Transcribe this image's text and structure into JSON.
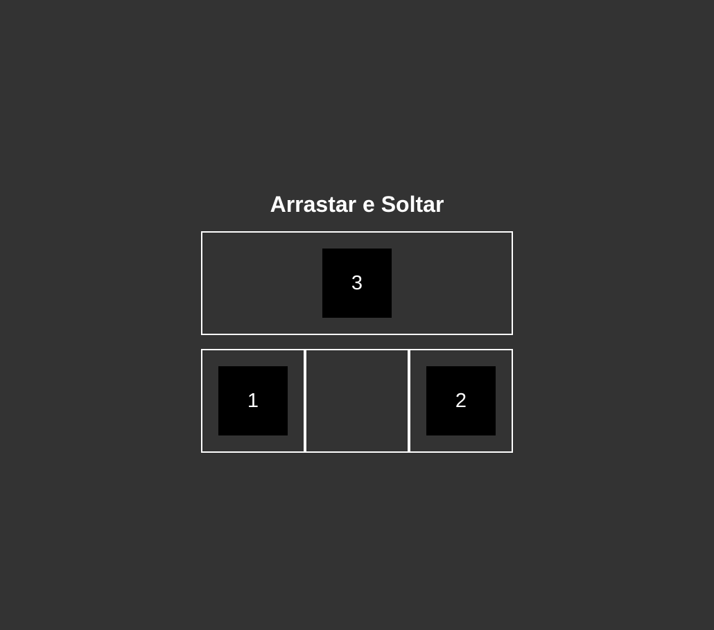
{
  "title": "Arrastar e Soltar",
  "dropzone": {
    "item_label": "3"
  },
  "slots": [
    {
      "item_label": "1"
    },
    {
      "item_label": ""
    },
    {
      "item_label": "2"
    }
  ],
  "colors": {
    "background": "#333333",
    "border": "#ffffff",
    "item_background": "#000000",
    "text": "#ffffff"
  }
}
